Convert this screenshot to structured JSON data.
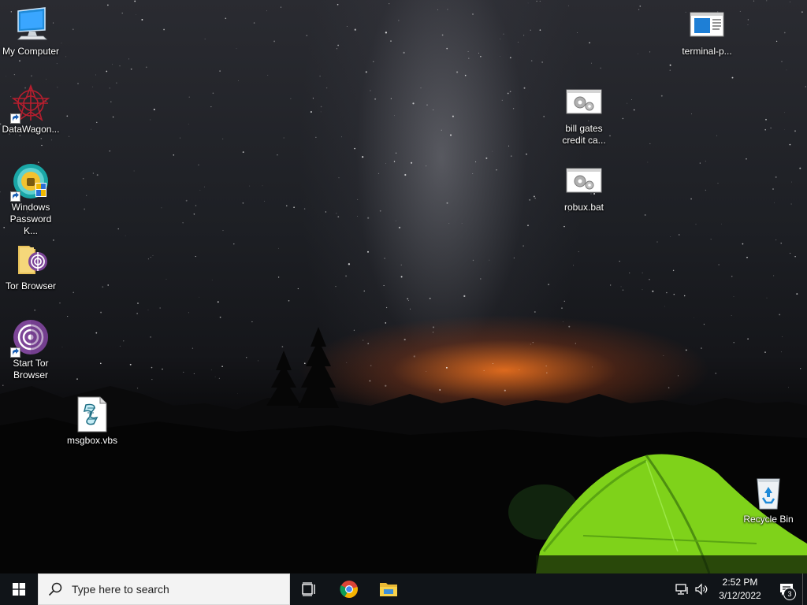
{
  "desktop": {
    "icons": [
      {
        "label": "My Computer",
        "icon": "computer-icon"
      },
      {
        "label": "DataWagon...",
        "icon": "datawagon-icon",
        "shortcut": true
      },
      {
        "label": "Windows Password K...",
        "icon": "password-key-icon",
        "shortcut": true
      },
      {
        "label": "Tor Browser",
        "icon": "tor-folder-icon"
      },
      {
        "label": "Start Tor Browser",
        "icon": "tor-onion-icon",
        "shortcut": true
      },
      {
        "label": "msgbox.vbs",
        "icon": "vbs-script-icon"
      },
      {
        "label": "terminal-p...",
        "icon": "terminal-window-icon"
      },
      {
        "label": "bill gates credit ca...",
        "icon": "batch-gears-icon"
      },
      {
        "label": "robux.bat",
        "icon": "batch-gears-icon"
      },
      {
        "label": "Recycle Bin",
        "icon": "recycle-bin-icon"
      }
    ]
  },
  "taskbar": {
    "search_placeholder": "Type here to search",
    "pinned": [
      "task-view-icon",
      "chrome-icon",
      "file-explorer-icon"
    ],
    "clock": {
      "time": "2:52 PM",
      "date": "3/12/2022"
    },
    "notification_count": "3"
  },
  "colors": {
    "taskbar_bg": "#101418",
    "tent_green": "#7fd21a",
    "horizon_glow": "#ff7a1e",
    "accent_blue": "#0078d7"
  }
}
